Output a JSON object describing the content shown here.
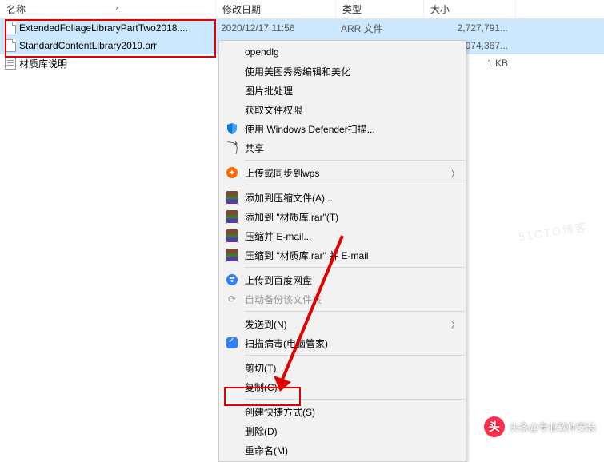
{
  "headers": {
    "name": "名称",
    "date": "修改日期",
    "type": "类型",
    "size": "大小"
  },
  "files": [
    {
      "name": "ExtendedFoliageLibraryPartTwo2018....",
      "date": "2020/12/17 11:56",
      "type": "ARR 文件",
      "size": "2,727,791..."
    },
    {
      "name": "StandardContentLibrary2019.arr",
      "date": "",
      "type": "",
      "size": "074,367..."
    },
    {
      "name": "材质库说明",
      "date": "",
      "type": "",
      "size": "1 KB"
    }
  ],
  "menu": {
    "opendlg": "opendlg",
    "meitu": "使用美图秀秀编辑和美化",
    "batch": "图片批处理",
    "perm": "获取文件权限",
    "defender": "使用 Windows Defender扫描...",
    "share": "共享",
    "wps": "上传或同步到wps",
    "rar_add": "添加到压缩文件(A)...",
    "rar_add2": "添加到 \"材质库.rar\"(T)",
    "rar_email": "压缩并 E-mail...",
    "rar_email2": "压缩到 \"材质库.rar\" 并 E-mail",
    "baidu": "上传到百度网盘",
    "autobak": "自动备份该文件夹",
    "sendto": "发送到(N)",
    "scan": "扫描病毒(电脑管家)",
    "cut": "剪切(T)",
    "copy": "复制(C)",
    "shortcut": "创建快捷方式(S)",
    "delete": "删除(D)",
    "rename": "重命名(M)"
  },
  "watermark": {
    "text": "头条@专业软件安装",
    "faint": "51CTO博客"
  }
}
